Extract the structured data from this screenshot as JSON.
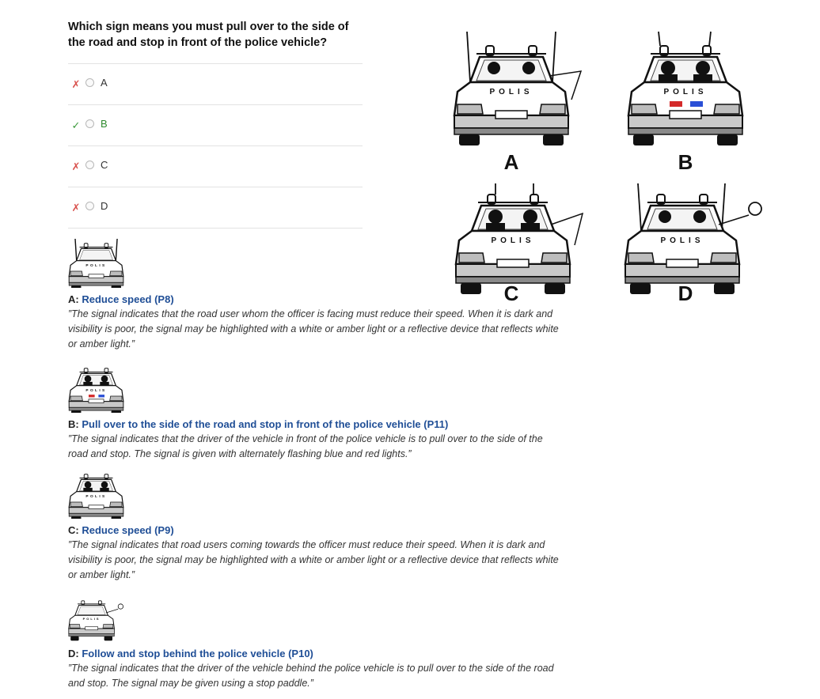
{
  "question": "Which sign means you must pull over to the side of the road and stop in front of the police vehicle?",
  "options": [
    {
      "letter": "A",
      "status": "wrong",
      "mark": "✗"
    },
    {
      "letter": "B",
      "status": "correct",
      "mark": "✓"
    },
    {
      "letter": "C",
      "status": "wrong",
      "mark": "✗"
    },
    {
      "letter": "D",
      "status": "wrong",
      "mark": "✗"
    }
  ],
  "figure": {
    "labels": [
      "A",
      "B",
      "C",
      "D"
    ],
    "plate_text": "POLIS"
  },
  "explanations": [
    {
      "label": "A:",
      "title": "Reduce speed (P8)",
      "quote": "”The signal indicates that the road user whom the officer is facing must reduce their speed. When it is dark and visibility is poor, the signal may be highlighted with a white or amber light or a reflective device that reflects white or amber light.”"
    },
    {
      "label": "B:",
      "title": "Pull over to the side of the road and stop in front of the police vehicle (P11)",
      "quote": "”The signal indicates that the driver of the vehicle in front of the police vehicle is to pull over to the side of the road and stop. The signal is given with alternately flashing blue and red lights.”"
    },
    {
      "label": "C:",
      "title": "Reduce speed (P9)",
      "quote": "”The signal indicates that road users coming towards the officer must reduce their speed. When it is dark and visibility is poor, the signal may be highlighted with a white or amber light or a reflective device that reflects white or amber light.”"
    },
    {
      "label": "D:",
      "title": "Follow and stop behind the police vehicle (P10)",
      "quote": "”The signal indicates that the driver of the vehicle behind the police vehicle is to pull over to the side of the road and stop. The signal may be given using a stop paddle.”"
    }
  ],
  "colors": {
    "link": "#1f4e96",
    "wrong": "#d9534f",
    "correct": "#3b9a3b",
    "blue_light": "#2a4fd6",
    "red_light": "#d42a2a"
  }
}
